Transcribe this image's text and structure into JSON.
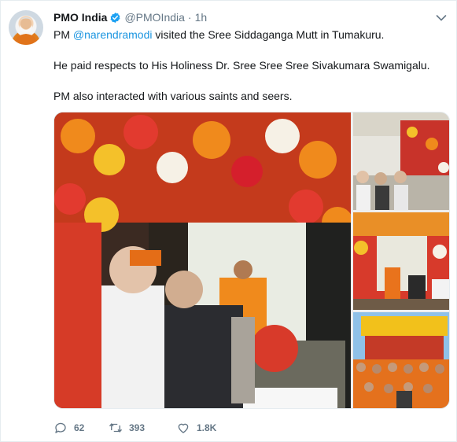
{
  "tweet": {
    "author_name": "PMO India",
    "author_handle": "@PMOIndia",
    "separator": "·",
    "time": "1h",
    "line1_prefix": "PM ",
    "line1_mention": "@narendramodi",
    "line1_suffix": " visited the Sree Siddaganga Mutt in Tumakuru.",
    "line2": "He paid respects to His Holiness Dr. Sree Sree Sree Sivakumara Swamigalu.",
    "line3": "PM also interacted with various saints and seers."
  },
  "media": {
    "photo_count": 4
  },
  "actions": {
    "reply_count": "62",
    "retweet_count": "393",
    "like_count": "1.8K"
  },
  "colors": {
    "link": "#1b95e0",
    "verified": "#1da1f2",
    "muted": "#657786",
    "text": "#14171a"
  },
  "icons": {
    "avatar": "avatar",
    "verified": "verified-badge-icon",
    "caret": "chevron-down-icon",
    "reply": "reply-icon",
    "retweet": "retweet-icon",
    "like": "heart-icon"
  }
}
